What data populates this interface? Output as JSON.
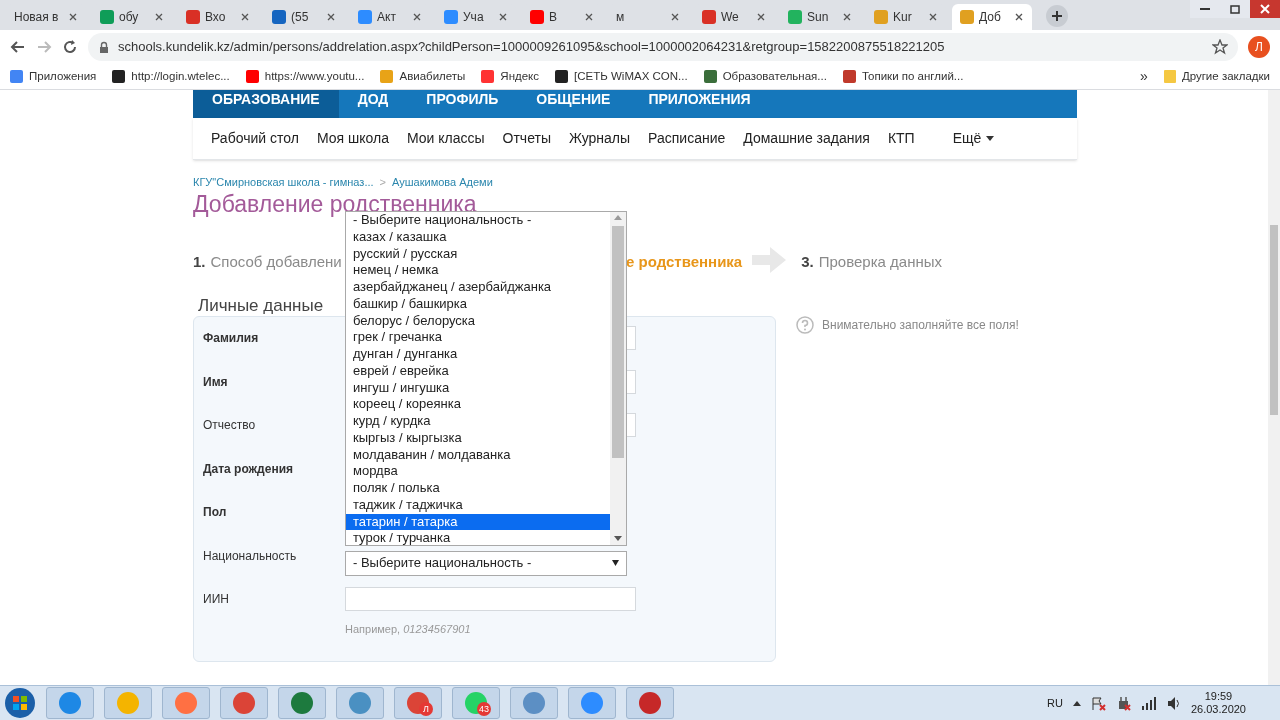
{
  "browser": {
    "tabs": [
      {
        "title": "Новая в",
        "selected": false
      },
      {
        "title": "обу",
        "selected": false,
        "color": "#0f9d58"
      },
      {
        "title": "Вхо",
        "selected": false,
        "color": "#d93025"
      },
      {
        "title": "(55",
        "selected": false,
        "color": "#1565c0"
      },
      {
        "title": "Акт",
        "selected": false,
        "color": "#2d8cff"
      },
      {
        "title": "Уча",
        "selected": false,
        "color": "#2d8cff"
      },
      {
        "title": "В",
        "selected": false,
        "color": "#ff0000"
      },
      {
        "title": "м",
        "selected": false
      },
      {
        "title": "We",
        "selected": false,
        "color": "#d93025"
      },
      {
        "title": "Sun",
        "selected": false,
        "color": "#22b35e"
      },
      {
        "title": "Kur",
        "selected": false,
        "color": "#e0a020"
      },
      {
        "title": "Доб",
        "selected": true,
        "color": "#e0a020"
      }
    ],
    "url": "schools.kundelik.kz/admin/persons/addrelation.aspx?childPerson=1000009261095&school=1000002064231&retgroup=1582200875518221205",
    "avatar": "Л",
    "bookmarks": [
      {
        "label": "Приложения",
        "color": "#4285f4"
      },
      {
        "label": "http://login.wtelec...",
        "color": "#222222"
      },
      {
        "label": "https://www.youtu...",
        "color": "#ff0000"
      },
      {
        "label": "Авиабилеты",
        "color": "#e8a317"
      },
      {
        "label": "Яндекс",
        "color": "#ff3333"
      },
      {
        "label": "[СЕТЬ WiMAX CON...",
        "color": "#222222"
      },
      {
        "label": "Образовательная...",
        "color": "#3b6e3b"
      },
      {
        "label": "Топики по англий...",
        "color": "#c0392b"
      }
    ],
    "bookmarks_more": "»",
    "other_bookmarks": "Другие закладки"
  },
  "site": {
    "top_nav": [
      {
        "label": "ОБРАЗОВАНИЕ",
        "selected": true
      },
      {
        "label": "ДОД",
        "selected": false
      },
      {
        "label": "ПРОФИЛЬ",
        "selected": false
      },
      {
        "label": "ОБЩЕНИЕ",
        "selected": false
      },
      {
        "label": "ПРИЛОЖЕНИЯ",
        "selected": false
      }
    ],
    "sub_nav": [
      "Рабочий стол",
      "Моя школа",
      "Мои классы",
      "Отчеты",
      "Журналы",
      "Расписание",
      "Домашние задания",
      "КТП"
    ],
    "sub_nav_more": "Ещё",
    "breadcrumbs": [
      "КГУ\"Смирновская школа - гимназ...",
      "Аушакимова Адеми"
    ],
    "breadcrumb_separator": ">",
    "page_title": "Добавление родственника",
    "steps": [
      {
        "number": "1.",
        "label": "Способ добавлени",
        "current": false
      },
      {
        "label": "е родственника",
        "current": true
      },
      {
        "number": "3.",
        "label": "Проверка данных",
        "current": false
      }
    ],
    "section_title": "Личные данные",
    "hint": "Внимательно заполняйте все поля!",
    "fields": [
      {
        "label": "Фамилия",
        "required": true,
        "kind": "text"
      },
      {
        "label": "Имя",
        "required": true,
        "kind": "text"
      },
      {
        "label": "Отчество",
        "required": false,
        "kind": "text"
      },
      {
        "label": "Дата рождения",
        "required": true,
        "kind": "none"
      },
      {
        "label": "Пол",
        "required": true,
        "kind": "none"
      },
      {
        "label": "Национальность",
        "required": false,
        "kind": "select",
        "value": "- Выберите национальность -"
      },
      {
        "label": "ИИН",
        "required": false,
        "kind": "text",
        "help": "Например, *01234567901*"
      }
    ],
    "dropdown_options": [
      {
        "label": "- Выберите национальность -",
        "selected": false
      },
      {
        "label": "казах / казашка",
        "selected": false
      },
      {
        "label": "русский / русская",
        "selected": false
      },
      {
        "label": "немец / немка",
        "selected": false
      },
      {
        "label": "азербайджанец / азербайджанка",
        "selected": false
      },
      {
        "label": "башкир / башкирка",
        "selected": false
      },
      {
        "label": "белорус / белоруска",
        "selected": false
      },
      {
        "label": "грек / гречанка",
        "selected": false
      },
      {
        "label": "дунган / дунганка",
        "selected": false
      },
      {
        "label": "еврей / еврейка",
        "selected": false
      },
      {
        "label": "ингуш / ингушка",
        "selected": false
      },
      {
        "label": "кореец / кореянка",
        "selected": false
      },
      {
        "label": "курд / курдка",
        "selected": false
      },
      {
        "label": "кыргыз / кыргызка",
        "selected": false
      },
      {
        "label": "молдаванин / молдаванка",
        "selected": false
      },
      {
        "label": "мордва",
        "selected": false
      },
      {
        "label": "поляк / полька",
        "selected": false
      },
      {
        "label": "таджик / таджичка",
        "selected": false
      },
      {
        "label": "татарин / татарка",
        "selected": true
      },
      {
        "label": "турок / турчанка",
        "selected": false
      }
    ]
  },
  "taskbar": {
    "apps": [
      {
        "color": "#1e88e5"
      },
      {
        "color": "#f4b400"
      },
      {
        "color": "#ff7043"
      },
      {
        "color": "#db4437"
      },
      {
        "color": "#1d7a3e"
      },
      {
        "color": "#4a90c2"
      },
      {
        "color": "#db4437",
        "badge": "Л"
      },
      {
        "color": "#25d366",
        "badge": "43"
      },
      {
        "color": "#5c8fc4"
      },
      {
        "color": "#2d8cff"
      },
      {
        "color": "#c62828"
      }
    ],
    "language": "RU",
    "time": "19:59",
    "date": "26.03.2020"
  }
}
